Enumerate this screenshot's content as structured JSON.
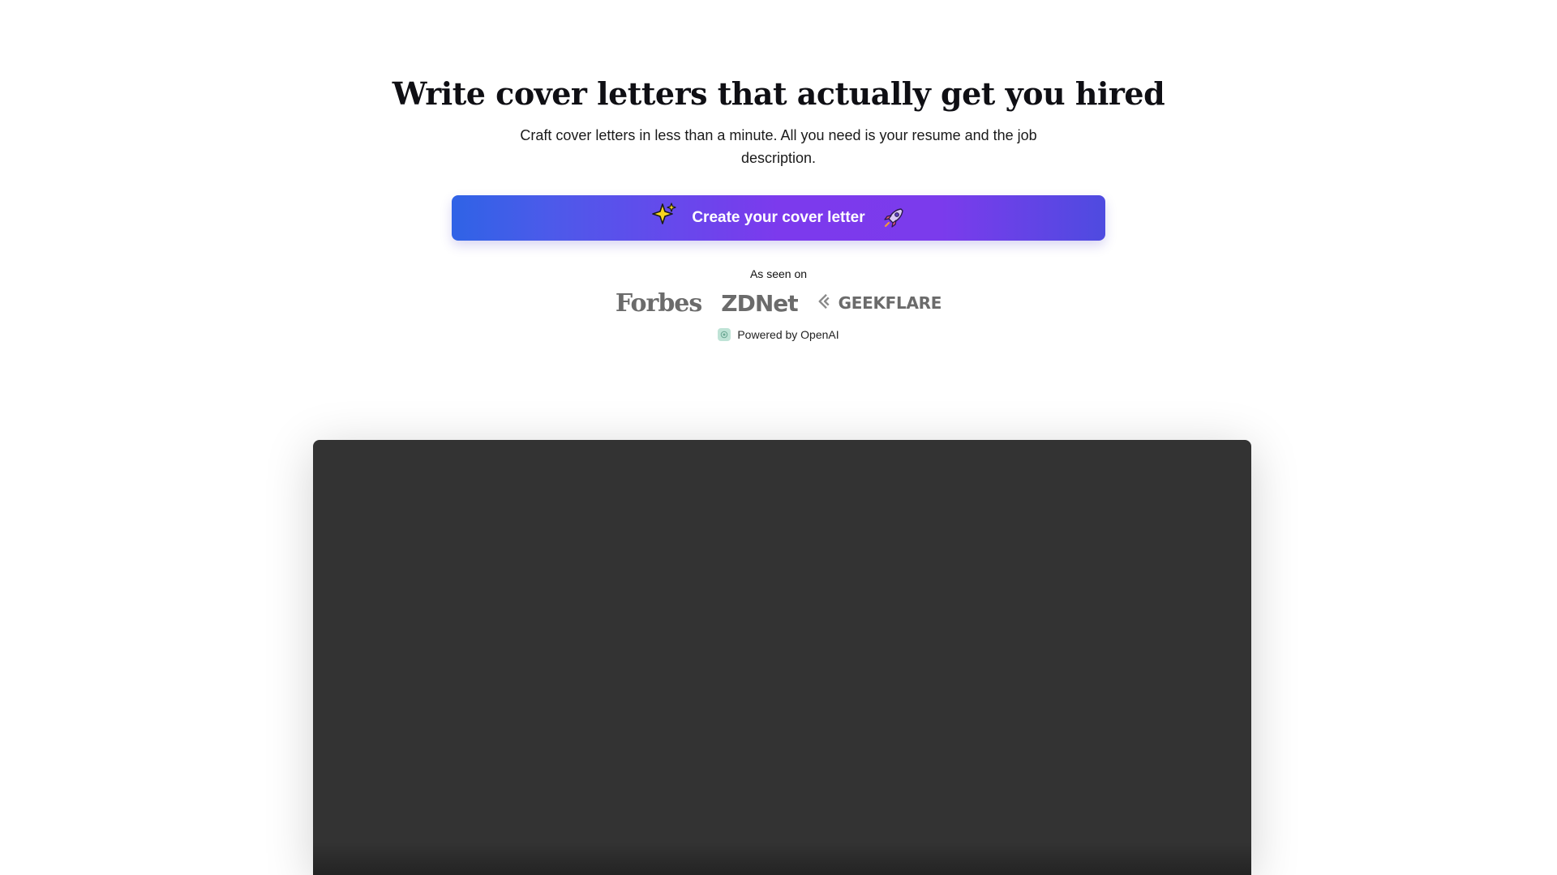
{
  "hero": {
    "headline": "Write cover letters that actually get you hired",
    "subhead": "Craft cover letters in less than a minute. All you need is your resume and the job description.",
    "cta_label": "Create your cover letter",
    "cta_icons": [
      "sparkles-icon",
      "rocket-icon"
    ],
    "cta_gradient": [
      "#2f63e6",
      "#7c3aed",
      "#4e4be0"
    ]
  },
  "press": {
    "label": "As seen on",
    "logos": [
      "Forbes",
      "ZDNet",
      "GEEKFLARE"
    ]
  },
  "powered": {
    "text": "Powered by OpenAI",
    "icon": "openai-icon"
  },
  "video": {
    "background": "#333333"
  }
}
